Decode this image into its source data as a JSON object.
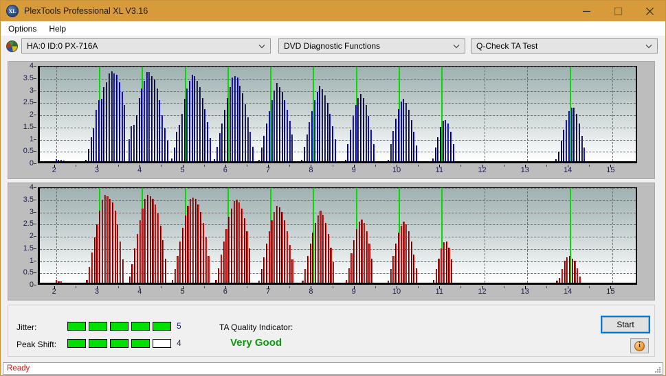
{
  "window": {
    "title": "PlexTools Professional XL V3.16",
    "icon": "XL",
    "minimize": "minimize-icon",
    "maximize": "maximize-icon",
    "close": "close-icon"
  },
  "menu": {
    "items": [
      {
        "label": "Options"
      },
      {
        "label": "Help"
      }
    ]
  },
  "toolbar": {
    "drive_select": {
      "value": "HA:0 ID:0  PX-716A"
    },
    "function_select": {
      "value": "DVD Diagnostic Functions"
    },
    "test_select": {
      "value": "Q-Check TA Test"
    }
  },
  "indicators": {
    "jitter_label": "Jitter:",
    "jitter_value": "5",
    "jitter_filled": 5,
    "jitter_total": 5,
    "peak_label": "Peak Shift:",
    "peak_value": "4",
    "peak_filled": 4,
    "peak_total": 5,
    "ta_label": "TA Quality Indicator:",
    "ta_value": "Very Good",
    "ta_color": "#0a9b0a",
    "meter_on_color": "#00e000"
  },
  "actions": {
    "start_label": "Start",
    "info_label": "i"
  },
  "statusbar": {
    "text": "Ready"
  },
  "chart_data": [
    {
      "id": "top",
      "type": "bar",
      "title": "",
      "xlabel": "",
      "ylabel": "",
      "series_color": "#1c1ce0",
      "marker_color": "#00dd00",
      "grid": true,
      "xlim": [
        1.62,
        15.62
      ],
      "ylim": [
        0,
        4
      ],
      "yticks": [
        0,
        0.5,
        1,
        1.5,
        2,
        2.5,
        3,
        3.5,
        4
      ],
      "ytick_labels": [
        "0",
        "0.5",
        "1",
        "1.5",
        "2",
        "2.5",
        "3",
        "3.5",
        "4"
      ],
      "xticks": [
        2,
        3,
        4,
        5,
        6,
        7,
        8,
        9,
        10,
        11,
        12,
        13,
        14,
        15
      ],
      "xtick_labels": [
        "2",
        "3",
        "4",
        "5",
        "6",
        "7",
        "8",
        "9",
        "10",
        "11",
        "12",
        "13",
        "14",
        "15"
      ],
      "markers": [
        3,
        4,
        5,
        6,
        7,
        8,
        9,
        10,
        11,
        14
      ],
      "bar_width": 0.032,
      "x": [
        2.0,
        2.06,
        2.12,
        2.18,
        2.7,
        2.76,
        2.82,
        2.88,
        2.94,
        3.0,
        3.06,
        3.12,
        3.18,
        3.24,
        3.3,
        3.36,
        3.42,
        3.48,
        3.54,
        3.6,
        3.7,
        3.76,
        3.82,
        3.88,
        3.94,
        4.0,
        4.06,
        4.12,
        4.18,
        4.24,
        4.3,
        4.36,
        4.42,
        4.48,
        4.54,
        4.6,
        4.7,
        4.76,
        4.82,
        4.88,
        4.94,
        5.0,
        5.06,
        5.12,
        5.18,
        5.24,
        5.3,
        5.36,
        5.42,
        5.48,
        5.54,
        5.6,
        5.7,
        5.76,
        5.82,
        5.88,
        5.94,
        6.0,
        6.06,
        6.12,
        6.18,
        6.24,
        6.3,
        6.36,
        6.42,
        6.48,
        6.54,
        6.6,
        6.74,
        6.8,
        6.86,
        6.92,
        6.98,
        7.04,
        7.1,
        7.16,
        7.22,
        7.28,
        7.34,
        7.4,
        7.46,
        7.52,
        7.74,
        7.8,
        7.86,
        7.92,
        7.98,
        8.04,
        8.1,
        8.16,
        8.22,
        8.28,
        8.34,
        8.4,
        8.46,
        8.52,
        8.76,
        8.82,
        8.88,
        8.94,
        9.0,
        9.06,
        9.12,
        9.18,
        9.24,
        9.3,
        9.36,
        9.42,
        9.76,
        9.82,
        9.88,
        9.94,
        10.0,
        10.06,
        10.12,
        10.18,
        10.24,
        10.3,
        10.36,
        10.42,
        10.8,
        10.86,
        10.92,
        10.98,
        11.04,
        11.1,
        11.16,
        11.22,
        11.28,
        13.68,
        13.74,
        13.8,
        13.86,
        13.92,
        13.98,
        14.04,
        14.1,
        14.16,
        14.22,
        14.28,
        14.34
      ],
      "values": [
        0.08,
        0.05,
        0.05,
        0.04,
        0.06,
        0.5,
        1.0,
        1.35,
        2.1,
        2.5,
        2.55,
        3.05,
        3.25,
        3.6,
        3.7,
        3.6,
        3.55,
        3.25,
        2.85,
        2.3,
        0.9,
        1.45,
        1.5,
        1.9,
        2.6,
        3.0,
        3.3,
        3.65,
        3.65,
        3.5,
        3.35,
        3.0,
        2.5,
        1.9,
        1.35,
        0.85,
        0.12,
        0.55,
        1.2,
        1.5,
        1.95,
        2.55,
        3.0,
        3.3,
        3.55,
        3.5,
        3.3,
        3.05,
        2.6,
        2.15,
        1.6,
        0.95,
        0.08,
        0.6,
        1.15,
        1.55,
        2.1,
        2.6,
        3.05,
        3.45,
        3.5,
        3.45,
        3.1,
        2.8,
        2.35,
        1.8,
        1.2,
        0.6,
        0.07,
        0.55,
        1.05,
        1.55,
        2.05,
        2.5,
        2.9,
        3.2,
        3.05,
        2.85,
        2.5,
        2.1,
        1.65,
        1.1,
        0.06,
        0.6,
        1.1,
        1.6,
        2.05,
        2.5,
        2.85,
        3.1,
        2.95,
        2.7,
        2.4,
        1.95,
        1.45,
        0.9,
        0.07,
        0.7,
        1.3,
        1.85,
        2.3,
        2.6,
        2.75,
        2.6,
        2.3,
        1.85,
        1.3,
        0.7,
        0.07,
        0.7,
        1.25,
        1.75,
        2.15,
        2.45,
        2.55,
        2.4,
        2.1,
        1.7,
        1.2,
        0.65,
        0.1,
        0.55,
        1.0,
        1.4,
        1.65,
        1.7,
        1.55,
        1.2,
        0.7,
        0.08,
        0.4,
        0.85,
        1.3,
        1.7,
        2.05,
        2.2,
        2.2,
        1.95,
        1.55,
        1.05,
        0.55
      ]
    },
    {
      "id": "bottom",
      "type": "bar",
      "title": "",
      "xlabel": "",
      "ylabel": "",
      "series_color": "#f01010",
      "marker_color": "#00dd00",
      "grid": true,
      "xlim": [
        1.62,
        15.62
      ],
      "ylim": [
        0,
        4
      ],
      "yticks": [
        0,
        0.5,
        1,
        1.5,
        2,
        2.5,
        3,
        3.5,
        4
      ],
      "ytick_labels": [
        "0",
        "0.5",
        "1",
        "1.5",
        "2",
        "2.5",
        "3",
        "3.5",
        "4"
      ],
      "xticks": [
        2,
        3,
        4,
        5,
        6,
        7,
        8,
        9,
        10,
        11,
        12,
        13,
        14,
        15
      ],
      "xtick_labels": [
        "2",
        "3",
        "4",
        "5",
        "6",
        "7",
        "8",
        "9",
        "10",
        "11",
        "12",
        "13",
        "14",
        "15"
      ],
      "markers": [
        3,
        4,
        5,
        6,
        7,
        8,
        9,
        10,
        11,
        14
      ],
      "bar_width": 0.036,
      "x": [
        2.0,
        2.06,
        2.12,
        2.72,
        2.78,
        2.84,
        2.9,
        2.96,
        3.02,
        3.08,
        3.14,
        3.2,
        3.26,
        3.32,
        3.38,
        3.44,
        3.5,
        3.56,
        3.72,
        3.78,
        3.84,
        3.9,
        3.96,
        4.02,
        4.08,
        4.14,
        4.2,
        4.26,
        4.32,
        4.38,
        4.44,
        4.5,
        4.56,
        4.72,
        4.78,
        4.84,
        4.9,
        4.96,
        5.02,
        5.08,
        5.14,
        5.2,
        5.26,
        5.32,
        5.38,
        5.44,
        5.5,
        5.56,
        5.74,
        5.8,
        5.86,
        5.92,
        5.98,
        6.04,
        6.1,
        6.16,
        6.22,
        6.28,
        6.34,
        6.4,
        6.46,
        6.52,
        6.74,
        6.8,
        6.86,
        6.92,
        6.98,
        7.04,
        7.1,
        7.16,
        7.22,
        7.28,
        7.34,
        7.4,
        7.46,
        7.52,
        7.76,
        7.82,
        7.88,
        7.94,
        8.0,
        8.06,
        8.12,
        8.18,
        8.24,
        8.3,
        8.36,
        8.42,
        8.48,
        8.78,
        8.84,
        8.9,
        8.96,
        9.02,
        9.08,
        9.14,
        9.2,
        9.26,
        9.32,
        9.38,
        9.76,
        9.82,
        9.88,
        9.94,
        10.0,
        10.06,
        10.12,
        10.18,
        10.24,
        10.3,
        10.36,
        10.42,
        10.82,
        10.88,
        10.94,
        11.0,
        11.06,
        11.12,
        11.18,
        11.24,
        13.7,
        13.76,
        13.82,
        13.88,
        13.94,
        14.0,
        14.06,
        14.12,
        14.18,
        14.24
      ],
      "values": [
        0.1,
        0.06,
        0.05,
        0.1,
        0.65,
        1.25,
        1.85,
        2.4,
        2.95,
        3.4,
        3.6,
        3.55,
        3.45,
        3.3,
        2.95,
        2.4,
        1.7,
        0.95,
        0.25,
        0.75,
        1.4,
        2.0,
        2.55,
        3.05,
        3.45,
        3.6,
        3.55,
        3.45,
        3.2,
        2.85,
        2.35,
        1.75,
        1.0,
        0.12,
        0.55,
        1.1,
        1.7,
        2.25,
        2.75,
        3.15,
        3.45,
        3.5,
        3.45,
        3.2,
        2.9,
        2.45,
        1.85,
        1.1,
        0.1,
        0.6,
        1.15,
        1.7,
        2.2,
        2.7,
        3.05,
        3.35,
        3.4,
        3.3,
        3.05,
        2.65,
        2.1,
        1.4,
        0.09,
        0.55,
        1.05,
        1.6,
        2.1,
        2.55,
        2.9,
        3.15,
        3.1,
        2.9,
        2.55,
        2.1,
        1.55,
        0.95,
        0.08,
        0.55,
        1.1,
        1.6,
        2.05,
        2.45,
        2.75,
        2.95,
        2.8,
        2.45,
        2.0,
        1.45,
        0.85,
        0.1,
        0.6,
        1.2,
        1.75,
        2.2,
        2.5,
        2.6,
        2.45,
        2.1,
        1.6,
        1.0,
        0.08,
        0.55,
        1.1,
        1.6,
        2.05,
        2.35,
        2.5,
        2.4,
        2.1,
        1.7,
        1.15,
        0.6,
        0.1,
        0.55,
        1.0,
        1.4,
        1.65,
        1.7,
        1.45,
        0.95,
        0.08,
        0.2,
        0.55,
        0.9,
        1.05,
        1.1,
        1.0,
        0.9,
        0.6,
        0.25
      ]
    }
  ]
}
